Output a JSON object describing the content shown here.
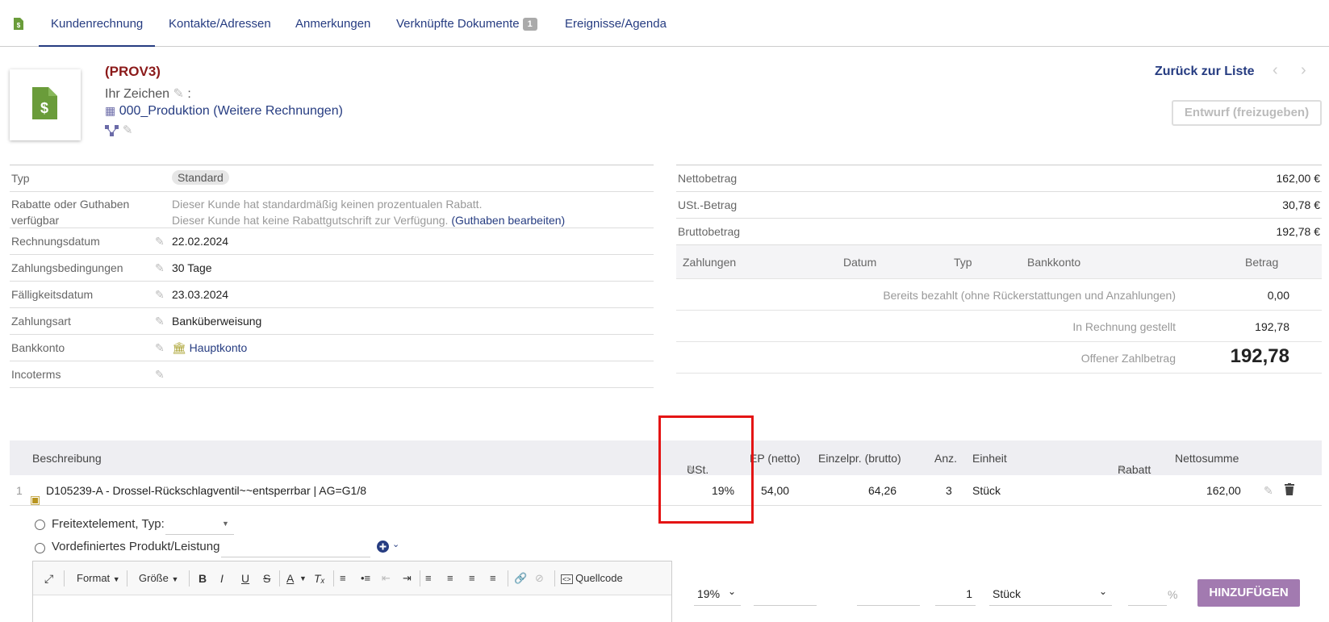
{
  "tabs": [
    {
      "label": "Kundenrechnung"
    },
    {
      "label": "Kontakte/Adressen"
    },
    {
      "label": "Anmerkungen"
    },
    {
      "label": "Verknüpfte Dokumente",
      "badge": "1"
    },
    {
      "label": "Ereignisse/Agenda"
    }
  ],
  "header": {
    "ref": "(PROV3)",
    "ihr_zeichen": "Ihr Zeichen",
    "ihr_zeichen_suffix": " :",
    "project": "000_Produktion",
    "project_extra": "(Weitere Rechnungen)",
    "back_label": "Zurück zur Liste",
    "status_button": "Entwurf (freizugeben)"
  },
  "info": {
    "typ_label": "Typ",
    "typ_value": "Standard",
    "rabatt_label": "Rabatte oder Guthaben verfügbar",
    "rabatt_line1": "Dieser Kunde hat standardmäßig keinen prozentualen Rabatt.",
    "rabatt_line2": "Dieser Kunde hat keine Rabattgutschrift zur Verfügung.",
    "guthaben_link": "(Guthaben bearbeiten)",
    "rechnungsdatum_label": "Rechnungsdatum",
    "rechnungsdatum_value": "22.02.2024",
    "zahlungsbedingungen_label": "Zahlungsbedingungen",
    "zahlungsbedingungen_value": "30 Tage",
    "faelligkeit_label": "Fälligkeitsdatum",
    "faelligkeit_value": "23.03.2024",
    "zahlungsart_label": "Zahlungsart",
    "zahlungsart_value": "Banküberweisung",
    "bankkonto_label": "Bankkonto",
    "bankkonto_value": "Hauptkonto",
    "incoterms_label": "Incoterms"
  },
  "totals": {
    "netto_label": "Nettobetrag",
    "netto_value": "162,00 €",
    "ust_label": "USt.-Betrag",
    "ust_value": "30,78 €",
    "brutto_label": "Bruttobetrag",
    "brutto_value": "192,78 €",
    "pay_headers": [
      "Zahlungen",
      "Datum",
      "Typ",
      "Bankkonto",
      "Betrag"
    ],
    "bereits_label": "Bereits bezahlt (ohne Rückerstattungen und Anzahlungen)",
    "bereits_value": "0,00",
    "gestellt_label": "In Rechnung gestellt",
    "gestellt_value": "192,78",
    "offen_label": "Offener Zahlbetrag",
    "offen_value": "192,78"
  },
  "positions": {
    "headers": {
      "beschreibung": "Beschreibung",
      "ust": "USt.",
      "ep_netto": "EP (netto)",
      "einzelpr_brutto": "Einzelpr. (brutto)",
      "anz": "Anz.",
      "einheit": "Einheit",
      "rabatt": "Rabatt",
      "nettosumme": "Nettosumme"
    },
    "row": {
      "num": "1",
      "description": "D105239-A - Drossel-Rückschlagventil~~entsperrbar | AG=G1/8",
      "ust": "19%",
      "ep_netto": "54,00",
      "einzelpr_brutto": "64,26",
      "anz": "3",
      "einheit": "Stück",
      "nettosumme": "162,00"
    }
  },
  "add": {
    "freitext_label": "Freitextelement, Typ:",
    "vordef_label": "Vordefiniertes Produkt/Leistung",
    "toolbar_format": "Format",
    "toolbar_groesse": "Größe",
    "toolbar_quellcode": "Quellcode",
    "ust_select": "19%",
    "qty_value": "1",
    "unit_select": "Stück",
    "percent_sign": "%",
    "add_button": "HINZUFÜGEN"
  }
}
